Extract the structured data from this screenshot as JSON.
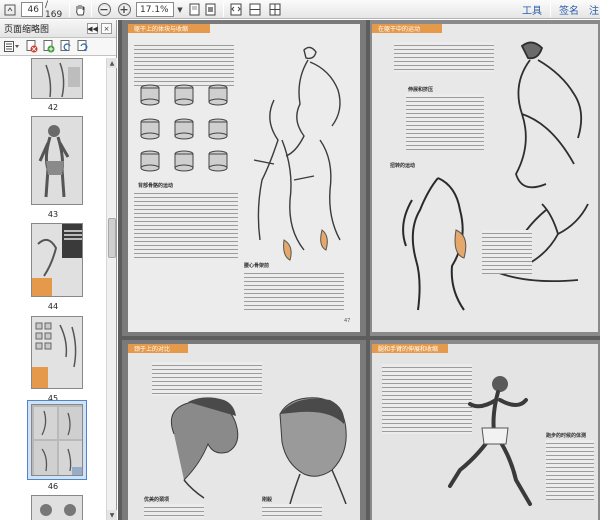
{
  "toolbar": {
    "page_current": "46",
    "page_total": "/ 169",
    "zoom_value": "17.1%",
    "tools_label": "工具",
    "sign_label": "签名",
    "overflow_label": "注"
  },
  "panel": {
    "title": "页面缩略图"
  },
  "thumbnails": [
    {
      "label": "42"
    },
    {
      "label": "43"
    },
    {
      "label": "44"
    },
    {
      "label": "45"
    },
    {
      "label": "46",
      "selected": true
    }
  ],
  "document": {
    "page_a": {
      "header": "躯干上的体块与收缩",
      "section": "背部骨骼的运动",
      "caption": "腰心骨架前",
      "page_no": "47"
    },
    "page_b": {
      "header": "在躯干中的运动",
      "note_1": "伸展和挤压",
      "note_2": "扭转的运动"
    },
    "page_c": {
      "header": "颈于上的对比",
      "caption_1": "优美的颈项",
      "caption_2": "刚毅"
    },
    "page_d": {
      "header": "腿和手臂的伸展和收缩",
      "caption": "跑步的时候的体测"
    }
  },
  "colors": {
    "accent_orange": "#e49a4a",
    "link_blue": "#2b5da6",
    "selection_blue": "#cfe2f6"
  }
}
